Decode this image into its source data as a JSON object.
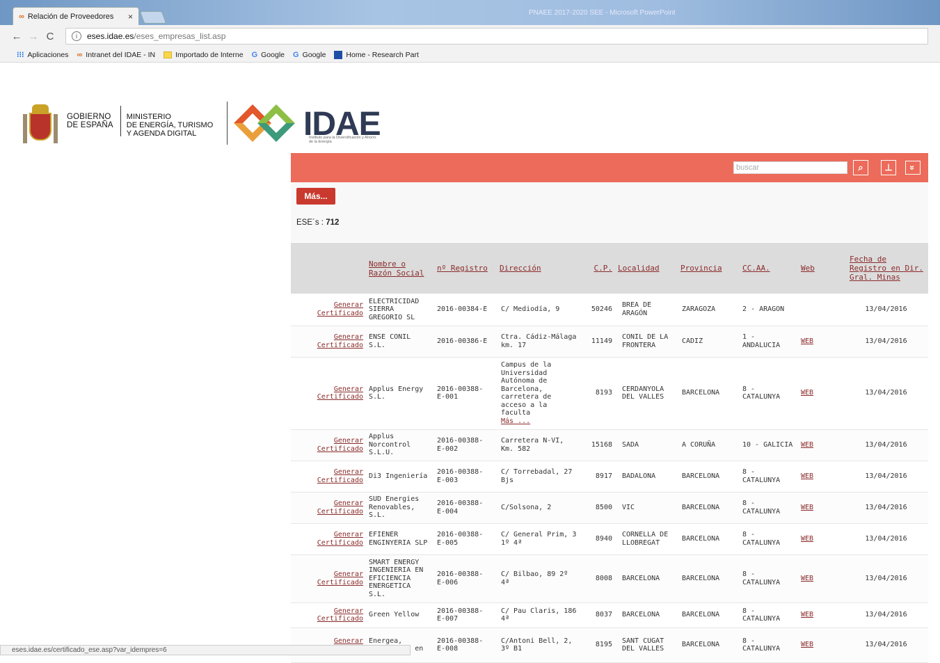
{
  "browser": {
    "tab_title": "Relación de Proveedores",
    "tab_close": "×",
    "window_title": "PNAEE 2017-2020 SEE - Microsoft PowerPoint",
    "url_host": "eses.idae.es",
    "url_path": "/eses_empresas_list.asp",
    "back_glyph": "←",
    "forward_glyph": "→",
    "reload_glyph": "C",
    "info_glyph": "i",
    "bookmarks": [
      {
        "label": "Aplicaciones"
      },
      {
        "label": "Intranet del IDAE - IN"
      },
      {
        "label": "Importado de Interne"
      },
      {
        "label": "Google"
      },
      {
        "label": "Google"
      },
      {
        "label": "Home - Research Part"
      }
    ]
  },
  "header": {
    "gobierno_line1": "GOBIERNO",
    "gobierno_line2": "DE ESPAÑA",
    "ministerio_line1": "MINISTERIO",
    "ministerio_line2": "DE ENERGÍA, TURISMO",
    "ministerio_line3": "Y AGENDA DIGITAL",
    "idae_logo": "IDAE",
    "idae_subtitle": "Instituto para la Diversificación y Ahorro de la Energía"
  },
  "toolbar": {
    "search_placeholder": "buscar",
    "search_icon": "⌕",
    "pin_icon": "⊥",
    "expand_icon": "»",
    "mas_button": "Más..."
  },
  "summary": {
    "label": "ESE´s :",
    "count": "712"
  },
  "table": {
    "headers": {
      "nombre": "Nombre o Razón Social",
      "registro": "nº Registro",
      "direccion": "Dirección",
      "cp": "C.P.",
      "localidad": "Localidad",
      "provincia": "Provincia",
      "ccaa": "CC.AA.",
      "web": "Web",
      "fecha": "Fecha de Registro en Dir. Gral. Minas"
    },
    "generar_label": "Generar Certificado",
    "rows": [
      {
        "nombre": "ELECTRICIDAD SIERRA GREGORIO SL",
        "registro": "2016-00384-E",
        "direccion": "C/ Mediodía, 9",
        "direccion_more": "",
        "cp": "50246",
        "localidad": "BREA DE ARAGÓN",
        "provincia": "ZARAGOZA",
        "ccaa": "2 - ARAGON",
        "web": "",
        "fecha": "13/04/2016"
      },
      {
        "nombre": "ENSE CONIL S.L.",
        "registro": "2016-00386-E",
        "direccion": "Ctra. Cádiz-Málaga km. 17",
        "direccion_more": "",
        "cp": "11149",
        "localidad": "CONIL DE LA FRONTERA",
        "provincia": "CADIZ",
        "ccaa": "1 - ANDALUCIA",
        "web": "WEB",
        "fecha": "13/04/2016"
      },
      {
        "nombre": "Applus Energy S.L.",
        "registro": "2016-00388-E-001",
        "direccion": "Campus de la Universidad Autónoma de Barcelona, carretera de acceso a la faculta",
        "direccion_more": "Más ...",
        "cp": "8193",
        "localidad": "CERDANYOLA DEL VALLES",
        "provincia": "BARCELONA",
        "ccaa": "8 - CATALUNYA",
        "web": "WEB",
        "fecha": "13/04/2016"
      },
      {
        "nombre": "Applus Norcontrol S.L.U.",
        "registro": "2016-00388-E-002",
        "direccion": "Carretera N-VI, Km. 582",
        "direccion_more": "",
        "cp": "15168",
        "localidad": "SADA",
        "provincia": "A CORUÑA",
        "ccaa": "10 - GALICIA",
        "web": "WEB",
        "fecha": "13/04/2016"
      },
      {
        "nombre": "Di3 Ingeniería",
        "registro": "2016-00388-E-003",
        "direccion": "C/ Torrebadal, 27 Bjs",
        "direccion_more": "",
        "cp": "8917",
        "localidad": "BADALONA",
        "provincia": "BARCELONA",
        "ccaa": "8 - CATALUNYA",
        "web": "WEB",
        "fecha": "13/04/2016"
      },
      {
        "nombre": "SUD Energies Renovables, S.L.",
        "registro": "2016-00388-E-004",
        "direccion": "C/Solsona, 2",
        "direccion_more": "",
        "cp": "8500",
        "localidad": "VIC",
        "provincia": "BARCELONA",
        "ccaa": "8 - CATALUNYA",
        "web": "WEB",
        "fecha": "13/04/2016"
      },
      {
        "nombre": "EFIENER ENGINYERIA SLP",
        "registro": "2016-00388-E-005",
        "direccion": "C/ General Prim, 3 1º 4ª",
        "direccion_more": "",
        "cp": "8940",
        "localidad": "CORNELLA DE LLOBREGAT",
        "provincia": "BARCELONA",
        "ccaa": "8 - CATALUNYA",
        "web": "WEB",
        "fecha": "13/04/2016"
      },
      {
        "nombre": "SMART ENERGY INGENIERIA EN EFICIENCIA ENERGETICA S.L.",
        "registro": "2016-00388-E-006",
        "direccion": "C/ Bilbao, 89 2º 4ª",
        "direccion_more": "",
        "cp": "8008",
        "localidad": "BARCELONA",
        "provincia": "BARCELONA",
        "ccaa": "8 - CATALUNYA",
        "web": "WEB",
        "fecha": "13/04/2016"
      },
      {
        "nombre": "Green Yellow",
        "registro": "2016-00388-E-007",
        "direccion": "C/ Pau Claris, 186 4ª",
        "direccion_more": "",
        "cp": "8037",
        "localidad": "BARCELONA",
        "provincia": "BARCELONA",
        "ccaa": "8 - CATALUNYA",
        "web": "WEB",
        "fecha": "13/04/2016"
      },
      {
        "nombre": "Energea, Ingeniería en",
        "registro": "2016-00388-E-008",
        "direccion": "C/Antoni Bell, 2, 3º B1",
        "direccion_more": "",
        "cp": "8195",
        "localidad": "SANT CUGAT DEL VALLES",
        "provincia": "BARCELONA",
        "ccaa": "8 - CATALUNYA",
        "web": "WEB",
        "fecha": "13/04/2016"
      }
    ]
  },
  "status_bar": "eses.idae.es/certificado_ese.asp?var_idempres=6"
}
